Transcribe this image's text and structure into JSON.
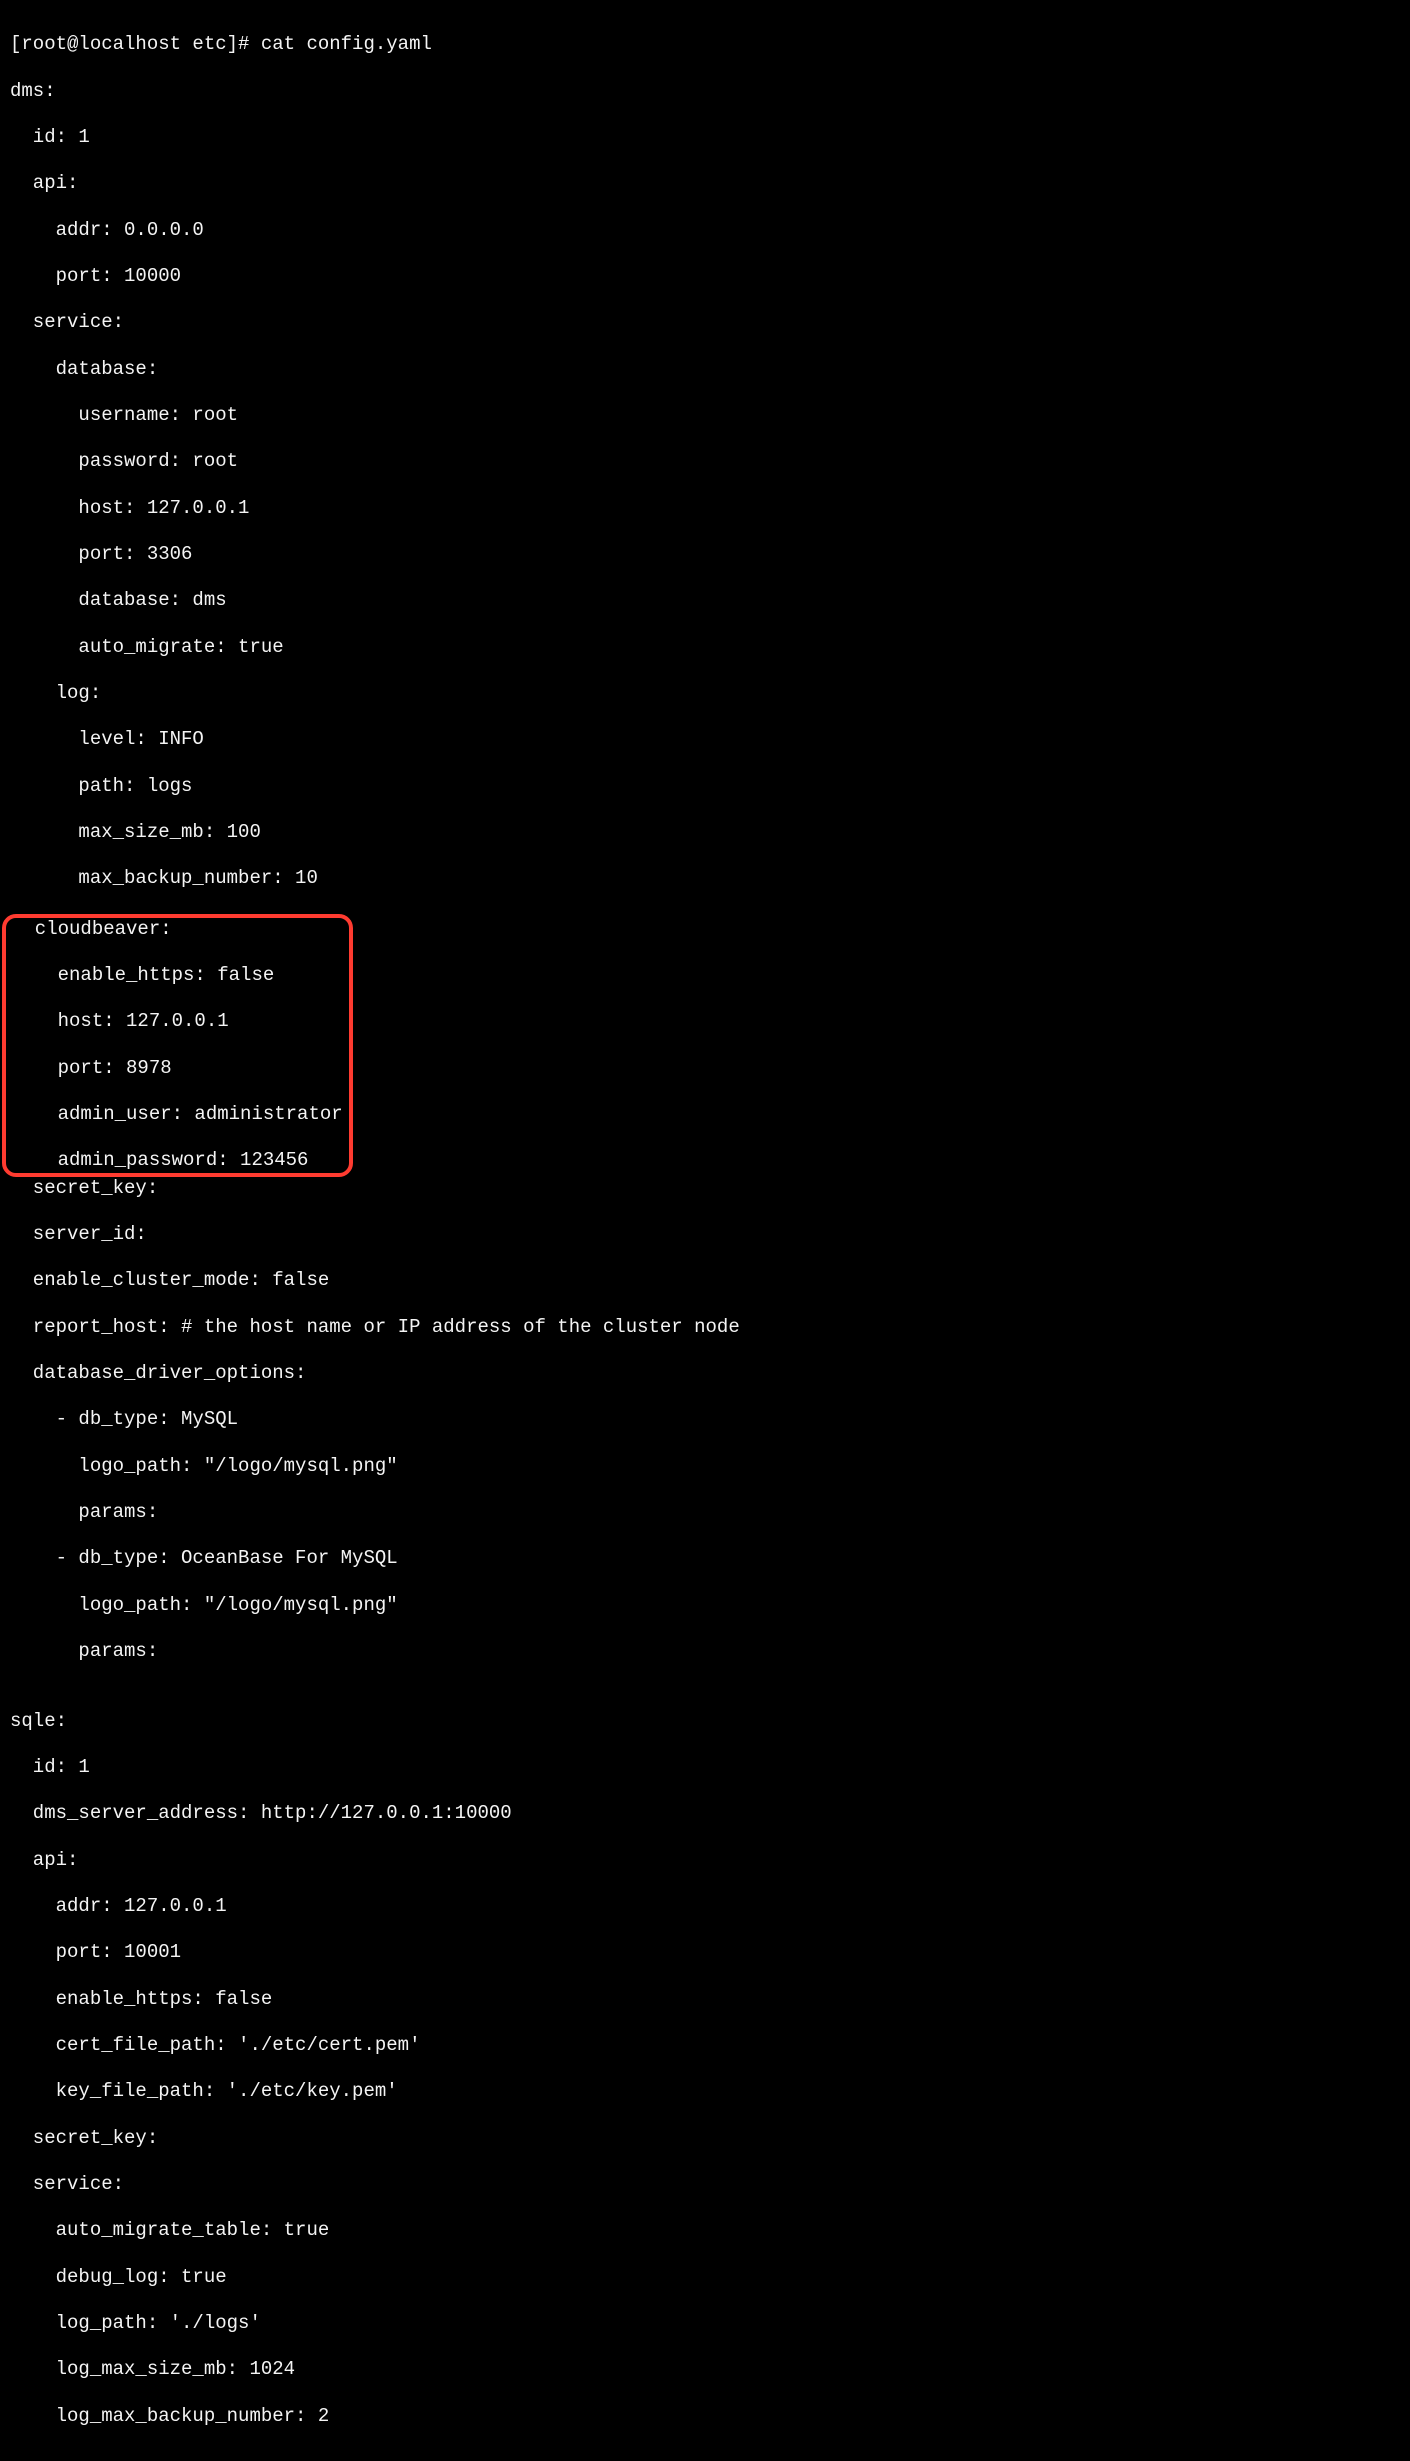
{
  "prompt_line": "[root@localhost etc]# cat config.yaml",
  "dms_key": "dms:",
  "dms_id": "  id: 1",
  "dms_api": "  api:",
  "dms_api_addr": "    addr: 0.0.0.0",
  "dms_api_port": "    port: 10000",
  "dms_service": "  service:",
  "dms_service_db": "    database:",
  "dms_db_user": "      username: root",
  "dms_db_pass": "      password: root",
  "dms_db_host": "      host: 127.0.0.1",
  "dms_db_port": "      port: 3306",
  "dms_db_name": "      database: dms",
  "dms_db_auto": "      auto_migrate: true",
  "dms_log": "    log:",
  "dms_log_level": "      level: INFO",
  "dms_log_path": "      path: logs",
  "dms_log_size": "      max_size_mb: 100",
  "dms_log_backup": "      max_backup_number: 10",
  "cb_key": "  cloudbeaver:",
  "cb_https": "    enable_https: false",
  "cb_host": "    host: 127.0.0.1",
  "cb_port": "    port: 8978",
  "cb_admin_user": "    admin_user: administrator",
  "cb_admin_pass": "    admin_password: 123456",
  "secret_key": "  secret_key:",
  "server_id": "  server_id:",
  "cluster_mode": "  enable_cluster_mode: false",
  "report_host": "  report_host: # the host name or IP address of the cluster node",
  "db_driver_opts": "  database_driver_options:",
  "drv1_type": "    - db_type: MySQL",
  "drv1_logo": "      logo_path: \"/logo/mysql.png\"",
  "drv1_params": "      params:",
  "drv2_type": "    - db_type: OceanBase For MySQL",
  "drv2_logo": "      logo_path: \"/logo/mysql.png\"",
  "drv2_params": "      params:",
  "blank": "",
  "sqle_key": "sqle:",
  "sqle_id": "  id: 1",
  "sqle_dms_addr": "  dms_server_address: http://127.0.0.1:10000",
  "sqle_api": "  api:",
  "sqle_api_addr": "    addr: 127.0.0.1",
  "sqle_api_port": "    port: 10001",
  "sqle_api_https": "    enable_https: false",
  "sqle_cert": "    cert_file_path: './etc/cert.pem'",
  "sqle_key_file": "    key_file_path: './etc/key.pem'",
  "sqle_secret": "  secret_key:",
  "sqle_service": "  service:",
  "sqle_svc_auto": "    auto_migrate_table: true",
  "sqle_svc_debug": "    debug_log: true",
  "sqle_svc_logpath": "    log_path: './logs'",
  "sqle_svc_logsize": "    log_max_size_mb: 1024",
  "sqle_svc_logbackup": "    log_max_backup_number: 2"
}
